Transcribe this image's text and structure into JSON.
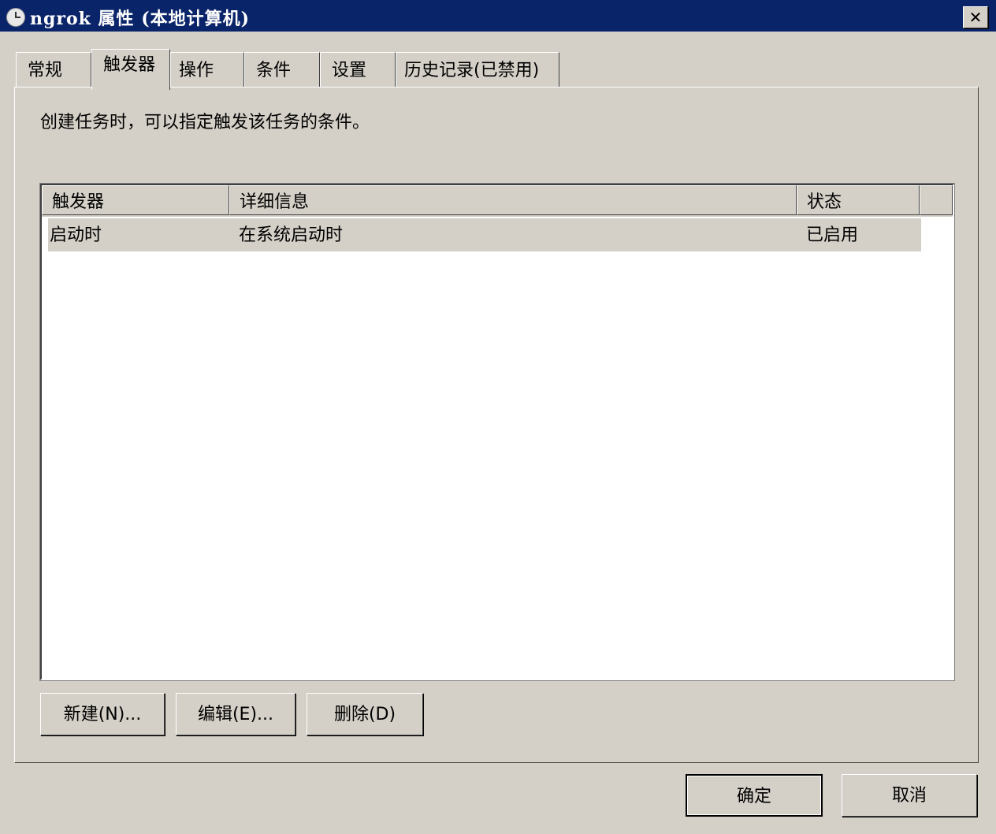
{
  "window": {
    "title": "ngrok 属性 (本地计算机)",
    "close_label": "✕"
  },
  "tabs": [
    {
      "label": "常规",
      "active": false
    },
    {
      "label": "触发器",
      "active": true
    },
    {
      "label": "操作",
      "active": false
    },
    {
      "label": "条件",
      "active": false
    },
    {
      "label": "设置",
      "active": false
    },
    {
      "label": "历史记录(已禁用)",
      "active": false
    }
  ],
  "panel": {
    "description": "创建任务时，可以指定触发该任务的条件。"
  },
  "table": {
    "columns": [
      "触发器",
      "详细信息",
      "状态"
    ],
    "rows": [
      [
        "启动时",
        "在系统启动时",
        "已启用"
      ]
    ]
  },
  "buttons": {
    "new": "新建(N)...",
    "edit": "编辑(E)...",
    "delete": "删除(D)",
    "ok": "确定",
    "cancel": "取消"
  },
  "colors": {
    "titlebar": "#0a246a",
    "face": "#d4d0c8"
  }
}
